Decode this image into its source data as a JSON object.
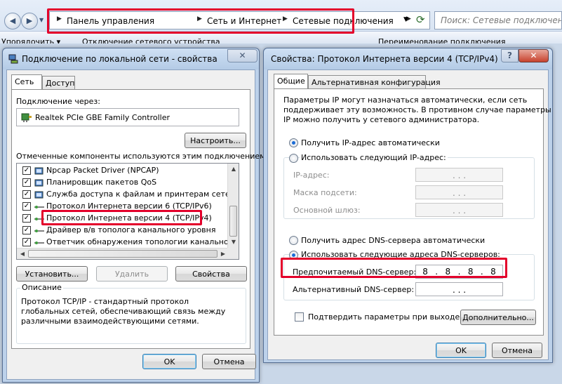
{
  "explorer": {
    "breadcrumbs": [
      "Панель управления",
      "Сеть и Интернет",
      "Сетевые подключения"
    ],
    "search_placeholder": "Поиск: Сетевые подключения",
    "toolbar_items": [
      "Упорядочить ▾",
      "Отключение сетевого устройства",
      "Переименование подключения"
    ]
  },
  "left_dialog": {
    "title": "Подключение по локальной сети - свойства",
    "close_label": "✕",
    "tabs": [
      "Сеть",
      "Доступ"
    ],
    "connect_via_label": "Подключение через:",
    "adapter_name": "Realtek PCIe GBE Family Controller",
    "configure_button": "Настроить...",
    "components_label": "Отмеченные компоненты используются этим подключением:",
    "components": [
      {
        "name": "Npcap Packet Driver (NPCAP)",
        "checked": true,
        "icon": "network-service-icon"
      },
      {
        "name": "Планировщик пакетов QoS",
        "checked": true,
        "icon": "network-service-icon"
      },
      {
        "name": "Служба доступа к файлам и принтерам сетей Micro",
        "checked": true,
        "icon": "network-service-icon"
      },
      {
        "name": "Протокол Интернета версии 6 (TCP/IPv6)",
        "checked": true,
        "icon": "protocol-icon"
      },
      {
        "name": "Протокол Интернета версии 4 (TCP/IPv4)",
        "checked": true,
        "icon": "protocol-icon"
      },
      {
        "name": "Драйвер в/в тополога канального уровня",
        "checked": true,
        "icon": "protocol-icon"
      },
      {
        "name": "Ответчик обнаружения топологии канального уров",
        "checked": true,
        "icon": "protocol-icon"
      }
    ],
    "install_button": "Установить...",
    "remove_button": "Удалить",
    "properties_button": "Свойства",
    "description_legend": "Описание",
    "description_text": "Протокол TCP/IP - стандартный протокол глобальных сетей, обеспечивающий связь между различными взаимодействующими сетями.",
    "ok_button": "OK",
    "cancel_button": "Отмена"
  },
  "right_dialog": {
    "title": "Свойства: Протокол Интернета версии 4 (TCP/IPv4)",
    "help_label": "?",
    "close_label": "✕",
    "tabs": [
      "Общие",
      "Альтернативная конфигурация"
    ],
    "intro_text_lines": [
      "Параметры IP могут назначаться автоматически, если сеть",
      "поддерживает эту возможность. В противном случае параметры",
      "IP можно получить у сетевого администратора."
    ],
    "radio_auto_ip": "Получить IP-адрес автоматически",
    "radio_manual_ip": "Использовать следующий IP-адрес:",
    "ip_label": "IP-адрес:",
    "mask_label": "Маска подсети:",
    "gateway_label": "Основной шлюз:",
    "ip_placeholder_dots": ".       .       .",
    "radio_auto_dns": "Получить адрес DNS-сервера автоматически",
    "radio_manual_dns": "Использовать следующие адреса DNS-серверов:",
    "preferred_dns_label": "Предпочитаемый DNS-сервер:",
    "preferred_dns_octets": [
      "8",
      ".",
      "8",
      ".",
      "8",
      ".",
      "8"
    ],
    "alternate_dns_label": "Альтернативный DNS-сервер:",
    "alternate_dns_dots": ".       .       .",
    "validate_label": "Подтвердить параметры при выходе",
    "advanced_button": "Дополнительно...",
    "ok_button": "OK",
    "cancel_button": "Отмена"
  },
  "colors": {
    "highlight": "#e3002b",
    "radio_selected": "#1a6bd6"
  }
}
